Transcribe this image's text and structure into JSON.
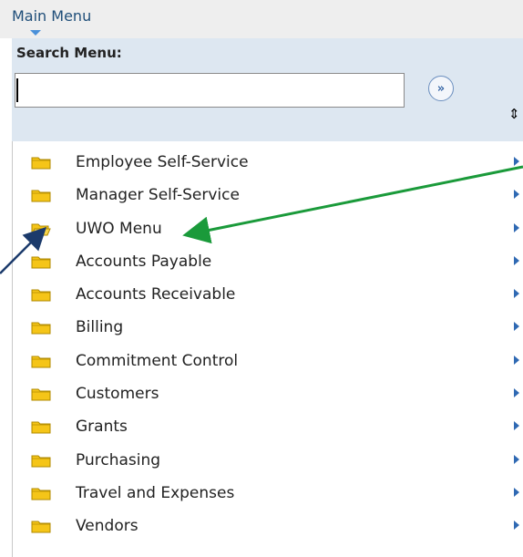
{
  "header": {
    "title": "Main Menu"
  },
  "search": {
    "label": "Search Menu:",
    "value": "",
    "go_icon": "double-chevron-right-icon"
  },
  "menu": {
    "items": [
      {
        "label": "Employee Self-Service"
      },
      {
        "label": "Manager Self-Service"
      },
      {
        "label": "UWO Menu"
      },
      {
        "label": "Accounts Payable"
      },
      {
        "label": "Accounts Receivable"
      },
      {
        "label": "Billing"
      },
      {
        "label": "Commitment Control"
      },
      {
        "label": "Customers"
      },
      {
        "label": "Grants"
      },
      {
        "label": "Purchasing"
      },
      {
        "label": "Travel and Expenses"
      },
      {
        "label": "Vendors"
      }
    ]
  },
  "colors": {
    "header_bg": "#eeeeee",
    "search_panel_bg": "#dde7f1",
    "folder_fill": "#f5c518",
    "arrow": "#2f69b3",
    "annotation_green": "#1a9a3a",
    "annotation_navy": "#1b3a6b"
  }
}
